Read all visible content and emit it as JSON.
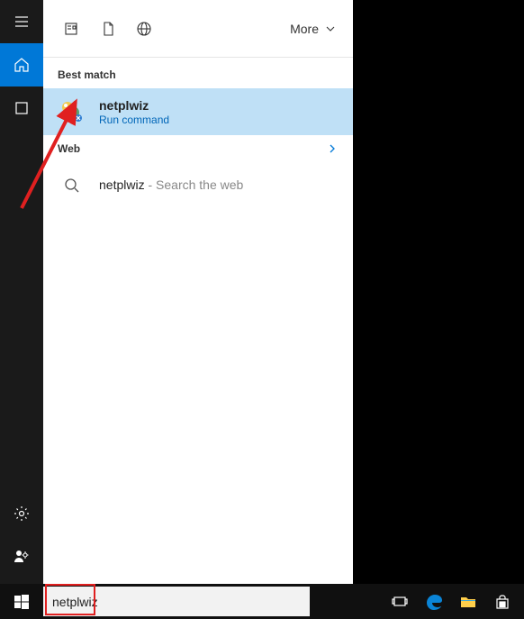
{
  "sidebar": {
    "items": [
      {
        "name": "hamburger"
      },
      {
        "name": "home",
        "active": true
      },
      {
        "name": "apps"
      }
    ],
    "footer": [
      {
        "name": "settings"
      },
      {
        "name": "account"
      }
    ]
  },
  "toolbar": {
    "more_label": "More"
  },
  "sections": {
    "best_match_label": "Best match",
    "web_label": "Web"
  },
  "best_match": {
    "title": "netplwiz",
    "subtitle": "Run command"
  },
  "web": {
    "query": "netplwiz",
    "hint": " - Search the web"
  },
  "search": {
    "value": "netplwiz"
  }
}
